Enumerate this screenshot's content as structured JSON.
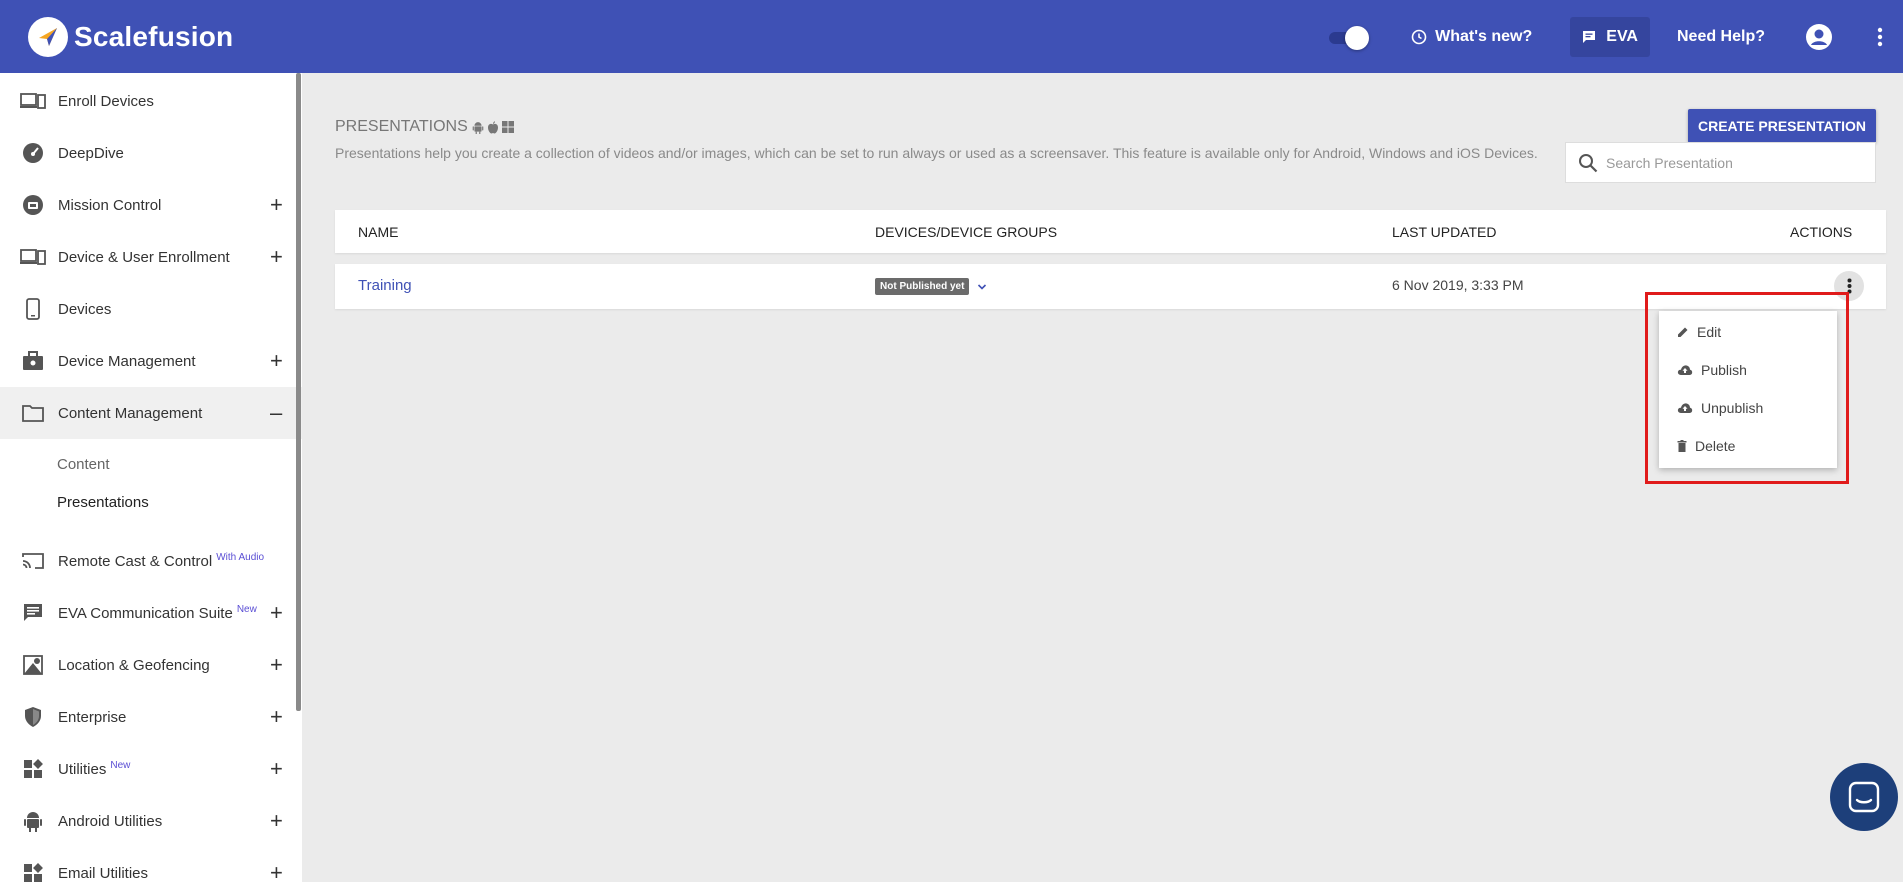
{
  "app": {
    "brand": "Scalefusion",
    "header": {
      "whats_new": "What's new?",
      "eva": "EVA",
      "help": "Need Help?"
    }
  },
  "sidebar": {
    "items": [
      {
        "label": "Enroll Devices",
        "icon": "enroll-devices-icon",
        "expandable": false
      },
      {
        "label": "DeepDive",
        "icon": "speedometer-icon",
        "expandable": false
      },
      {
        "label": "Mission Control",
        "icon": "mission-control-icon",
        "expandable": true
      },
      {
        "label": "Device & User Enrollment",
        "icon": "device-enrollment-icon",
        "expandable": true
      },
      {
        "label": "Devices",
        "icon": "phone-icon",
        "expandable": false
      },
      {
        "label": "Device Management",
        "icon": "briefcase-icon",
        "expandable": true
      },
      {
        "label": "Content Management",
        "icon": "folder-icon",
        "expandable": true,
        "expanded": true
      }
    ],
    "sub_items": [
      "Content",
      "Presentations"
    ],
    "items_after": [
      {
        "label": "Remote Cast & Control",
        "sup": "With Audio",
        "icon": "cast-icon",
        "expandable": false
      },
      {
        "label": "EVA Communication Suite",
        "sup": "New",
        "icon": "chat-icon",
        "expandable": true
      },
      {
        "label": "Location & Geofencing",
        "icon": "map-icon",
        "expandable": true
      },
      {
        "label": "Enterprise",
        "icon": "shield-icon",
        "expandable": true
      },
      {
        "label": "Utilities",
        "sup": "New",
        "icon": "widgets-icon",
        "expandable": true
      },
      {
        "label": "Android Utilities",
        "icon": "android-icon",
        "expandable": true
      },
      {
        "label": "Email Utilities",
        "icon": "widgets-icon",
        "expandable": true
      }
    ],
    "plus": "+",
    "minus": "–"
  },
  "page": {
    "title": "PRESENTATIONS",
    "description": "Presentations help you create a collection of videos and/or images, which can be set to run always or used as a screensaver. This feature is available only for Android, Windows and iOS Devices.",
    "create_button": "CREATE PRESENTATION",
    "search_placeholder": "Search Presentation"
  },
  "table": {
    "headers": [
      "NAME",
      "DEVICES/DEVICE GROUPS",
      "LAST UPDATED",
      "ACTIONS"
    ],
    "rows": [
      {
        "name": "Training",
        "status": "Not Published yet",
        "updated": "6 Nov 2019, 3:33 PM"
      }
    ]
  },
  "menu": {
    "items": [
      {
        "label": "Edit",
        "icon": "pencil-icon"
      },
      {
        "label": "Publish",
        "icon": "cloud-upload-icon"
      },
      {
        "label": "Unpublish",
        "icon": "cloud-download-icon"
      },
      {
        "label": "Delete",
        "icon": "trash-icon"
      }
    ]
  },
  "colors": {
    "header": "#3f51b5",
    "highlight": "#e01b1b",
    "link": "#3f51b5"
  }
}
